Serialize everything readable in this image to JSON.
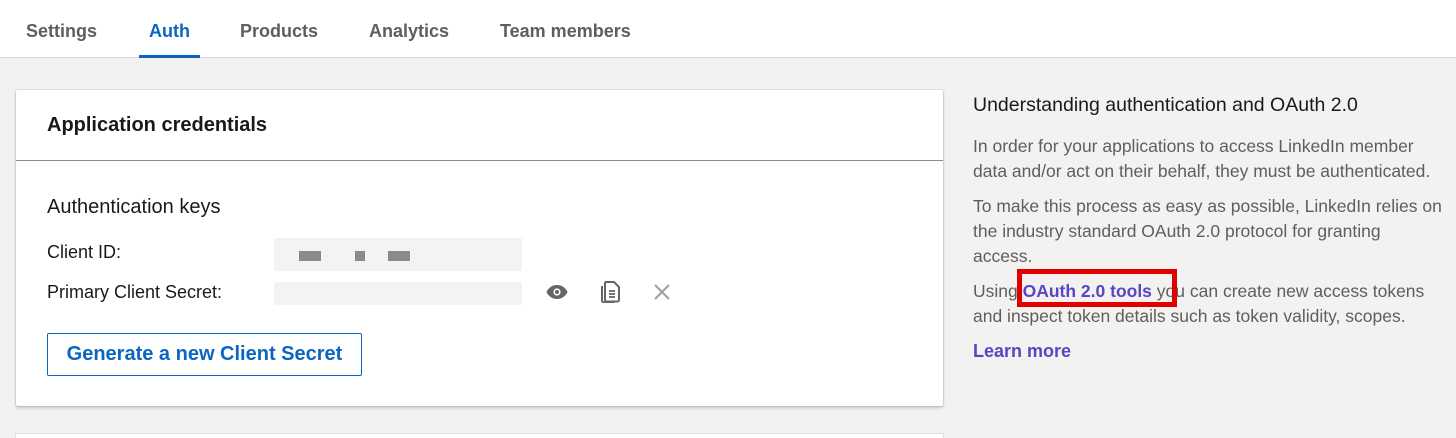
{
  "tabs": [
    {
      "label": "Settings",
      "active": false
    },
    {
      "label": "Auth",
      "active": true
    },
    {
      "label": "Products",
      "active": false
    },
    {
      "label": "Analytics",
      "active": false
    },
    {
      "label": "Team members",
      "active": false
    }
  ],
  "credentials": {
    "title": "Application credentials",
    "section_title": "Authentication keys",
    "client_id_label": "Client ID:",
    "client_secret_label": "Primary Client Secret:",
    "generate_button": "Generate a new Client Secret",
    "icons": [
      "eye-icon",
      "copy-icon",
      "close-icon"
    ]
  },
  "aside": {
    "title": "Understanding authentication and OAuth 2.0",
    "p1": "In order for your applications to access LinkedIn member data and/or act on their behalf, they must be authenticated.",
    "p2": "To make this process as easy as possible, LinkedIn relies on the industry standard OAuth 2.0 protocol for granting access.",
    "p3_before": "Using ",
    "p3_link": "OAuth 2.0 tools",
    "p3_after": " you can create new access tokens and inspect token details such as token validity, scopes.",
    "learn_more": "Learn more"
  },
  "colors": {
    "brand_blue": "#0a66c2",
    "link_purple": "#5b44c5",
    "highlight_red": "#e00000",
    "page_bg": "#f3f2f0"
  }
}
